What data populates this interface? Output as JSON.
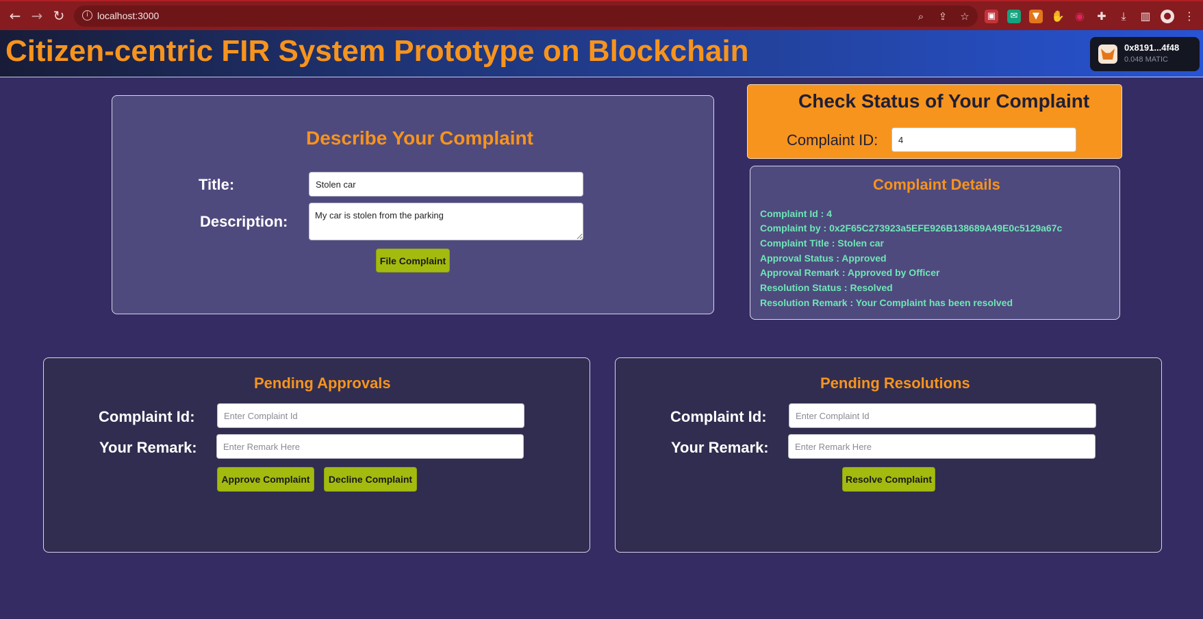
{
  "browser": {
    "url": "localhost:3000",
    "back_icon": "arrow-left-icon",
    "forward_icon": "arrow-right-icon",
    "reload_icon": "reload-icon",
    "info_icon": "info-icon",
    "toolbar_icons": [
      "zoom-icon",
      "share-icon",
      "star-icon"
    ],
    "extension_icons": [
      "ext-red-icon",
      "ext-green-icon",
      "metamask-icon",
      "hand-icon",
      "target-icon",
      "puzzle-icon",
      "download-icon",
      "sidebar-icon",
      "profile-icon",
      "more-icon"
    ]
  },
  "header": {
    "title": "Citizen-centric FIR System Prototype on Blockchain",
    "title_color": "#f7941d"
  },
  "wallet": {
    "address": "0x8191...4f48",
    "balance": "0.048 MATIC"
  },
  "describe": {
    "heading": "Describe Your Complaint",
    "title_label": "Title:",
    "title_value": "Stolen car",
    "description_label": "Description:",
    "description_value": "My car is stolen from the parking",
    "file_button": "File Complaint"
  },
  "status": {
    "heading": "Check Status of Your Complaint",
    "id_label": "Complaint ID:",
    "id_value": "4"
  },
  "details": {
    "heading": "Complaint Details",
    "lines": [
      "Complaint Id : 4",
      "Complaint by : 0x2F65C273923a5EFE926B138689A49E0c5129a67c",
      "Complaint Title : Stolen car",
      "Approval Status : Approved",
      "Approval Remark : Approved by Officer",
      "Resolution Status : Resolved",
      "Resolution Remark : Your Complaint has been resolved"
    ]
  },
  "approvals": {
    "heading": "Pending Approvals",
    "id_label": "Complaint Id:",
    "id_placeholder": "Enter Complaint Id",
    "remark_label": "Your Remark:",
    "remark_placeholder": "Enter Remark Here",
    "approve_button": "Approve Complaint",
    "decline_button": "Decline Complaint"
  },
  "resolutions": {
    "heading": "Pending Resolutions",
    "id_label": "Complaint Id:",
    "id_placeholder": "Enter Complaint Id",
    "remark_label": "Your Remark:",
    "remark_placeholder": "Enter Remark Here",
    "resolve_button": "Resolve Complaint"
  },
  "colors": {
    "background": "#352c64",
    "accent": "#f7941d",
    "button": "#a3bb0f",
    "detail_text": "#6ee7b7"
  }
}
